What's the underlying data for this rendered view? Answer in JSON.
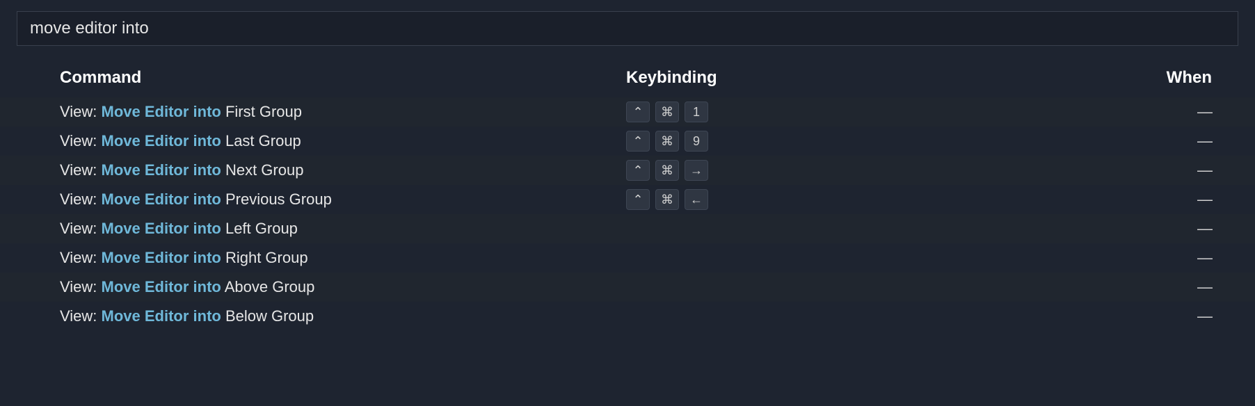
{
  "search": {
    "value": "move editor into"
  },
  "headers": {
    "command": "Command",
    "keybinding": "Keybinding",
    "when": "When"
  },
  "empty_marker": "—",
  "keys": {
    "ctrl": "⌃",
    "cmd": "⌘",
    "num1": "1",
    "num9": "9",
    "right": "→",
    "left": "←"
  },
  "rows": [
    {
      "prefix": "View: ",
      "highlight": "Move Editor into",
      "suffix": " First Group",
      "keybinding": [
        "ctrl",
        "cmd",
        "num1"
      ],
      "when": "empty"
    },
    {
      "prefix": "View: ",
      "highlight": "Move Editor into",
      "suffix": " Last Group",
      "keybinding": [
        "ctrl",
        "cmd",
        "num9"
      ],
      "when": "empty"
    },
    {
      "prefix": "View: ",
      "highlight": "Move Editor into",
      "suffix": " Next Group",
      "keybinding": [
        "ctrl",
        "cmd",
        "right"
      ],
      "when": "empty"
    },
    {
      "prefix": "View: ",
      "highlight": "Move Editor into",
      "suffix": " Previous Group",
      "keybinding": [
        "ctrl",
        "cmd",
        "left"
      ],
      "when": "empty"
    },
    {
      "prefix": "View: ",
      "highlight": "Move Editor into",
      "suffix": " Left Group",
      "keybinding": [],
      "when": "empty"
    },
    {
      "prefix": "View: ",
      "highlight": "Move Editor into",
      "suffix": " Right Group",
      "keybinding": [],
      "when": "empty"
    },
    {
      "prefix": "View: ",
      "highlight": "Move Editor into",
      "suffix": " Above Group",
      "keybinding": [],
      "when": "empty"
    },
    {
      "prefix": "View: ",
      "highlight": "Move Editor into",
      "suffix": " Below Group",
      "keybinding": [],
      "when": "empty"
    }
  ]
}
